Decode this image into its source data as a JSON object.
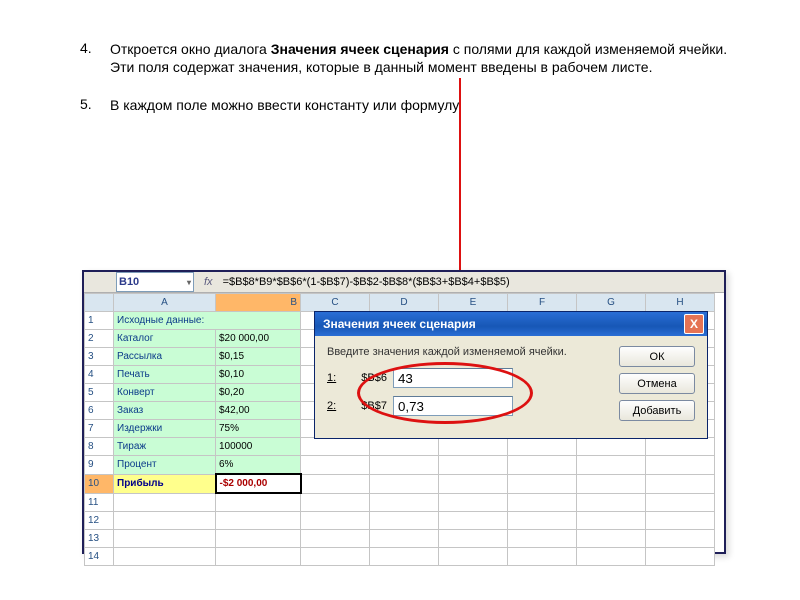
{
  "list": {
    "items": [
      {
        "num": "4.",
        "pre": "Откроется окно диалога ",
        "bold": "Значения ячеек сценария",
        "post": "  с полями для каждой изменяемой ячейки. Эти поля содержат значения, которые в данный момент введены в рабочем листе."
      },
      {
        "num": "5.",
        "pre": "В каждом поле можно ввести константу или формулу.",
        "bold": "",
        "post": ""
      }
    ]
  },
  "excel": {
    "nameBox": "B10",
    "fxLabel": "fx",
    "formula": "=$B$8*B9*$B$6*(1-$B$7)-$B$2-$B$8*($B$3+$B$4+$B$5)",
    "cols": [
      "A",
      "B",
      "C",
      "D",
      "E",
      "F",
      "G",
      "H"
    ],
    "rows": [
      {
        "n": "1",
        "a": "Исходные данные:",
        "b": ""
      },
      {
        "n": "2",
        "a": "Каталог",
        "b": "$20 000,00"
      },
      {
        "n": "3",
        "a": "Рассылка",
        "b": "$0,15"
      },
      {
        "n": "4",
        "a": "Печать",
        "b": "$0,10"
      },
      {
        "n": "5",
        "a": "Конверт",
        "b": "$0,20"
      },
      {
        "n": "6",
        "a": "Заказ",
        "b": "$42,00"
      },
      {
        "n": "7",
        "a": "Издержки",
        "b": "75%"
      },
      {
        "n": "8",
        "a": "Тираж",
        "b": "100000"
      },
      {
        "n": "9",
        "a": "Процент",
        "b": "6%"
      },
      {
        "n": "10",
        "a": "Прибыль",
        "b": "-$2 000,00"
      },
      {
        "n": "11",
        "a": "",
        "b": ""
      },
      {
        "n": "12",
        "a": "",
        "b": ""
      },
      {
        "n": "13",
        "a": "",
        "b": ""
      },
      {
        "n": "14",
        "a": "",
        "b": ""
      }
    ]
  },
  "dialog": {
    "title": "Значения ячеек сценария",
    "close": "X",
    "instruction": "Введите значения каждой изменяемой ячейки.",
    "fields": [
      {
        "idx": "1:",
        "ref": "$B$6",
        "value": "43"
      },
      {
        "idx": "2:",
        "ref": "$B$7",
        "value": "0,73"
      }
    ],
    "buttons": {
      "ok": "ОК",
      "cancel": "Отмена",
      "add": "Добавить"
    }
  }
}
